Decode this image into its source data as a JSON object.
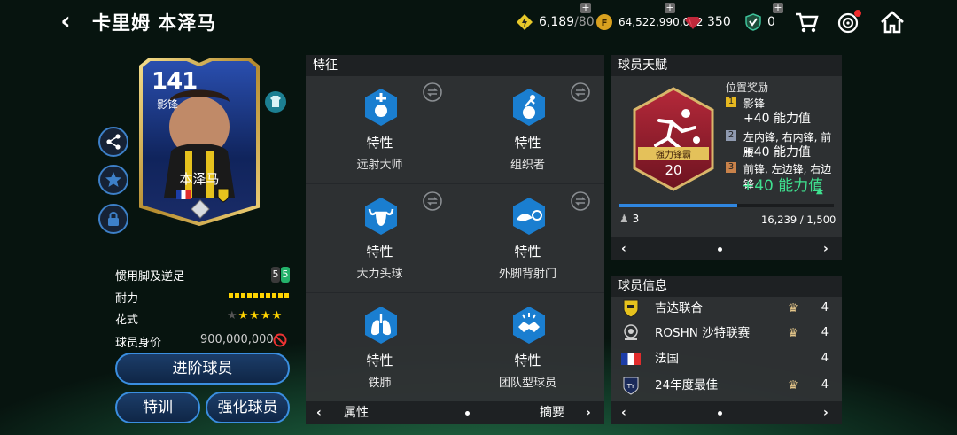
{
  "header": {
    "title": "卡里姆 本泽马",
    "back_icon": "‹"
  },
  "resources": {
    "energy": "6,189",
    "energy_max": "/80",
    "coins": "64,522,990,012",
    "gems": "350",
    "tokens": "0"
  },
  "card": {
    "rating": "141",
    "position": "影锋",
    "name": "本泽马"
  },
  "stats": {
    "foot_label": "惯用脚及逆足",
    "foot_strong": "5",
    "foot_weak": "5",
    "stamina_label": "耐力",
    "skill_label": "花式",
    "skill_stars": 4,
    "value_label": "球员身价",
    "value": "900,000,000"
  },
  "buttons": {
    "advance": "进阶球员",
    "train": "特训",
    "enhance": "强化球员"
  },
  "traits": {
    "header": "特征",
    "items": [
      {
        "title": "特性",
        "name": "远射大师",
        "icon": "shooting-ball-icon"
      },
      {
        "title": "特性",
        "name": "组织者",
        "icon": "playmaker-icon"
      },
      {
        "title": "特性",
        "name": "大力头球",
        "icon": "bull-icon"
      },
      {
        "title": "特性",
        "name": "外脚背射门",
        "icon": "outside-foot-icon"
      },
      {
        "title": "特性",
        "name": "铁肺",
        "icon": "lungs-icon"
      },
      {
        "title": "特性",
        "name": "团队型球员",
        "icon": "team-player-icon"
      }
    ],
    "nav": {
      "left": "属性",
      "right": "摘要"
    }
  },
  "talent": {
    "header": "球员天赋",
    "badge_name": "强力锋霸",
    "badge_level": "20",
    "reward_title": "位置奖励",
    "rewards": [
      {
        "rank": "1",
        "pos": "影锋",
        "bonus": "+40 能力值",
        "color": "#e6b820"
      },
      {
        "rank": "2",
        "pos": "左内锋, 右内锋, 前腰",
        "bonus": "+40 能力值",
        "color": "#8f9ab0"
      },
      {
        "rank": "3",
        "pos": "前锋, 左边锋, 右边锋",
        "bonus": "+40 能力值",
        "color": "#c9824a"
      }
    ],
    "boost_count": "3",
    "progress": "16,239 / 1,500",
    "progress_fraction": 0.55
  },
  "info": {
    "header": "球员信息",
    "rows": [
      {
        "label": "吉达联合",
        "score": "4"
      },
      {
        "label": "ROSHN 沙特联赛",
        "score": "4"
      },
      {
        "label": "法国",
        "score": "4"
      },
      {
        "label": "24年度最佳",
        "score": "4"
      }
    ]
  },
  "colors": {
    "accent": "#2f86e0",
    "gold": "#ffd400",
    "positive": "#3fe08f",
    "panel": "#303335"
  }
}
